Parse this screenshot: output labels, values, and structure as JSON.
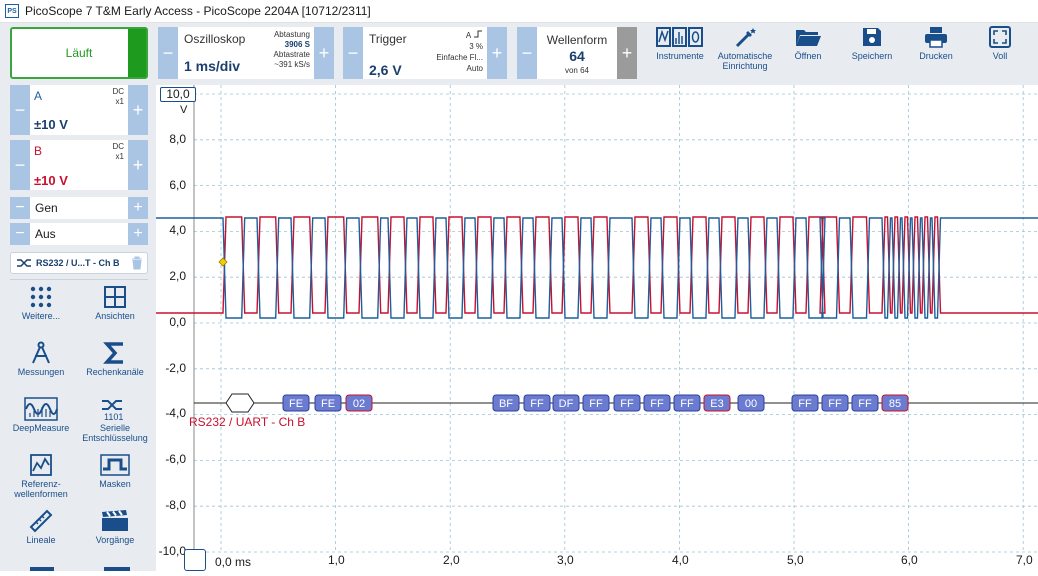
{
  "titlebar": {
    "logo": "PS",
    "title": "PicoScope 7 T&M Early Access  - PicoScope 2204A [10712/2311]"
  },
  "toolbar": {
    "run_label": "Läuft",
    "oscilloscope": {
      "title": "Oszilloskop",
      "timebase": "1 ms/div",
      "samples_label": "Abtastung",
      "samples_value": "3906 S",
      "rate_label": "Abtastrate",
      "rate_value": "~391 kS/s"
    },
    "trigger": {
      "title": "Trigger",
      "level": "2,6 V",
      "channel": "A",
      "percent": "3 %",
      "mode_label": "Einfache Fl...",
      "mode": "Auto"
    },
    "waveform": {
      "title": "Wellenform",
      "count": "64",
      "of": "von 64"
    },
    "tools": [
      {
        "icon": "instruments-icon",
        "label": "Instrumente"
      },
      {
        "icon": "auto-setup-icon",
        "label": "Automatische Einrichtung"
      },
      {
        "icon": "open-folder-icon",
        "label": "Öffnen"
      },
      {
        "icon": "save-icon",
        "label": "Speichern"
      },
      {
        "icon": "print-icon",
        "label": "Drucken"
      },
      {
        "icon": "fullscreen-icon",
        "label": "Voll"
      }
    ]
  },
  "channels": {
    "a": {
      "name": "A",
      "coupling": "DC",
      "probe": "x1",
      "range": "±10 V",
      "color": "#1b5f9e"
    },
    "b": {
      "name": "B",
      "coupling": "DC",
      "probe": "x1",
      "range": "±10 V",
      "color": "#c8102e"
    },
    "gen_label": "Gen",
    "aus_label": "Aus",
    "decoder_label": "RS232 / U...T - Ch B"
  },
  "side_tools": [
    {
      "icon": "more-grid-icon",
      "label": "Weitere..."
    },
    {
      "icon": "views-icon",
      "label": "Ansichten"
    },
    {
      "icon": "measurements-icon",
      "label": "Messungen"
    },
    {
      "icon": "math-sigma-icon",
      "label": "Rechenkanäle"
    },
    {
      "icon": "deepmeasure-icon",
      "label": "DeepMeasure"
    },
    {
      "icon": "serial-decode-icon",
      "label": "Serielle Entschlüsselung"
    },
    {
      "icon": "reference-waveform-icon",
      "label": "Referenz-wellenformen"
    },
    {
      "icon": "masks-icon",
      "label": "Masken"
    },
    {
      "icon": "ruler-icon",
      "label": "Lineale"
    },
    {
      "icon": "clapper-icon",
      "label": "Vorgänge"
    }
  ],
  "scope": {
    "y_axis": {
      "top_marker": "10,0",
      "unit": "V",
      "ticks": [
        "8,0",
        "6,0",
        "4,0",
        "2,0",
        "0,0",
        "-2,0",
        "-4,0",
        "-6,0",
        "-8,0",
        "-10,0"
      ]
    },
    "x_axis": {
      "ticks": [
        "0,0 ms",
        "1,0",
        "2,0",
        "3,0",
        "4,0",
        "5,0",
        "6,0",
        "7,0"
      ]
    },
    "decoder": {
      "label": "RS232 / UART - Ch B",
      "bytes": [
        "FE",
        "FE",
        "02",
        "BF",
        "FF",
        "DF",
        "FF",
        "FF",
        "FF",
        "FF",
        "E3",
        "00",
        "FF",
        "FF",
        "FF",
        "85"
      ]
    },
    "colors": {
      "channel_a": "#1b5f9e",
      "channel_b": "#c8102e",
      "grid": "#9cc4d6",
      "decode_box": "#6a7bd0",
      "trigger_marker": "#f0d000"
    }
  }
}
